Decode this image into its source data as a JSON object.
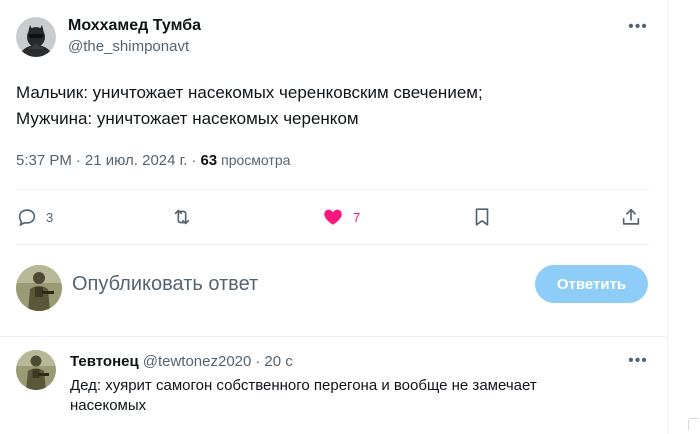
{
  "tweet": {
    "author_name": "Моххамед Тумба",
    "author_handle": "@the_shimponavt",
    "text": "Мальчик: уничтожает насекомых черенковским свечением;\nМужчина: уничтожает насекомых черенком",
    "time": "5:37 PM",
    "separator": "·",
    "date": "21 июл. 2024 г.",
    "views_count": "63",
    "views_label": "просмотра",
    "more_icon": "more-horizontal-icon"
  },
  "actions": {
    "reply_count": "3",
    "retweet_count": "",
    "like_count": "7",
    "like_color": "#f91880",
    "icons": [
      "reply-icon",
      "retweet-icon",
      "like-icon",
      "bookmark-icon",
      "share-icon"
    ]
  },
  "composer": {
    "placeholder": "Опубликовать ответ",
    "button_label": "Ответить",
    "button_color": "#8ecdf8"
  },
  "reply": {
    "author_name": "Тевтонец",
    "author_handle": "@tewtonez2020",
    "separator": "·",
    "time": "20 с",
    "text": "Дед: хуярит самогон собственного перегона и вообще не замечает насекомых"
  },
  "colors": {
    "text_primary": "#0f1419",
    "text_secondary": "#536471",
    "divider": "#eff3f4"
  }
}
